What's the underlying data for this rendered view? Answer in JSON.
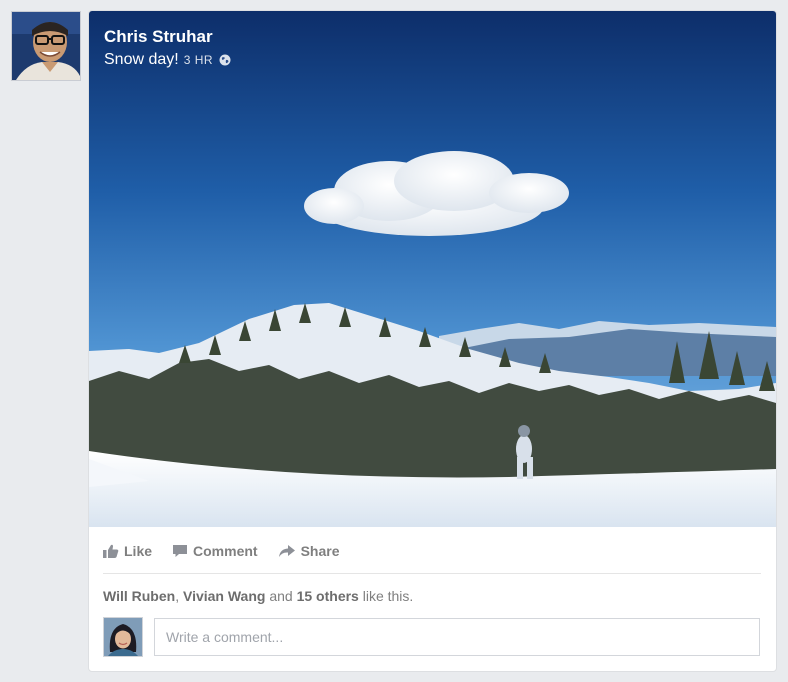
{
  "post": {
    "author": "Chris Struhar",
    "caption": "Snow day!",
    "time": "3 HR",
    "privacy_icon": "globe-icon"
  },
  "actions": {
    "like": "Like",
    "comment": "Comment",
    "share": "Share"
  },
  "likes": {
    "name1": "Will Ruben",
    "sep": ", ",
    "name2": "Vivian Wang",
    "and": " and ",
    "others": "15 others",
    "suffix": " like this."
  },
  "comment_box": {
    "placeholder": "Write a comment..."
  },
  "colors": {
    "background": "#e9ebee",
    "action_text": "#7f7f7f"
  }
}
